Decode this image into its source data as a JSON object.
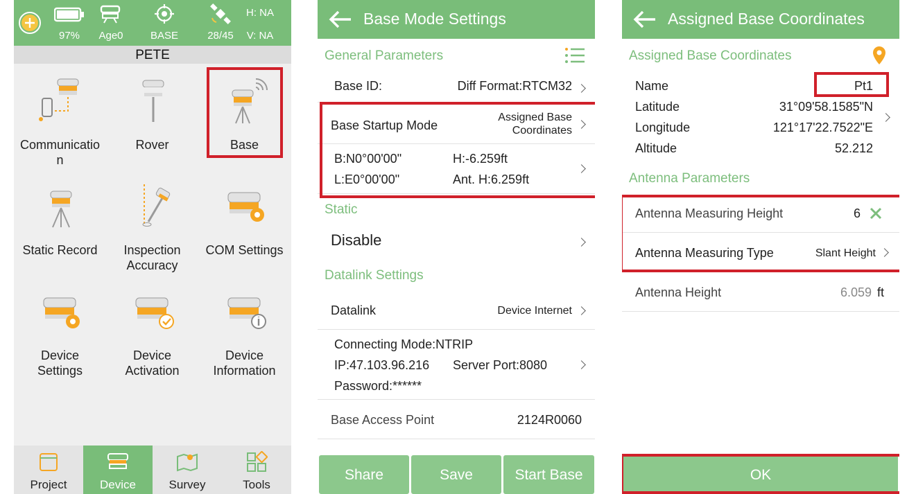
{
  "device_menu": {
    "status": {
      "battery": "97%",
      "age": "Age0",
      "base": "BASE",
      "satellites": "28/45",
      "h": "H: NA",
      "v": "V: NA"
    },
    "project_name": "PETE",
    "tiles": [
      {
        "label": "Communicatio\nn",
        "icon": "communication-icon"
      },
      {
        "label": "Rover",
        "icon": "rover-icon"
      },
      {
        "label": "Base",
        "icon": "base-icon"
      },
      {
        "label": "Static Record",
        "icon": "static-record-icon"
      },
      {
        "label": "Inspection\nAccuracy",
        "icon": "inspection-accuracy-icon"
      },
      {
        "label": "COM Settings",
        "icon": "com-settings-icon"
      },
      {
        "label": "Device\nSettings",
        "icon": "device-settings-icon"
      },
      {
        "label": "Device\nActivation",
        "icon": "device-activation-icon"
      },
      {
        "label": "Device\nInformation",
        "icon": "device-information-icon"
      }
    ],
    "nav": [
      {
        "label": "Project"
      },
      {
        "label": "Device"
      },
      {
        "label": "Survey"
      },
      {
        "label": "Tools"
      }
    ]
  },
  "base_mode": {
    "title": "Base Mode Settings",
    "general_parameters": "General Parameters",
    "base_id_label": "Base ID:",
    "diff_format": "Diff Format:RTCM32",
    "startup_label": "Base Startup Mode",
    "startup_value_1": "Assigned Base",
    "startup_value_2": "Coordinates",
    "b": "B:N0°00'00\"",
    "l": "L:E0°00'00\"",
    "h": "H:-6.259ft",
    "ant_h": "Ant. H:6.259ft",
    "static_section": "Static",
    "static_value": "Disable",
    "datalink_section": "Datalink Settings",
    "datalink_label": "Datalink",
    "datalink_value": "Device Internet",
    "connecting_mode": "Connecting Mode:NTRIP",
    "ip": "IP:47.103.96.216",
    "server_port": "Server Port:8080",
    "password": "Password:******",
    "access_point_label": "Base Access Point",
    "access_point_value": "2124R0060",
    "buttons": {
      "share": "Share",
      "save": "Save",
      "start": "Start Base"
    }
  },
  "assigned": {
    "title": "Assigned Base Coordinates",
    "section": "Assigned Base Coordinates",
    "name_label": "Name",
    "name_value": "Pt1",
    "lat_label": "Latitude",
    "lat_value": "31°09'58.1585\"N",
    "lon_label": "Longitude",
    "lon_value": "121°17'22.7522\"E",
    "alt_label": "Altitude",
    "alt_value": "52.212",
    "antenna_section": "Antenna Parameters",
    "amh_label": "Antenna Measuring Height",
    "amh_value": "6",
    "amt_label": "Antenna Measuring Type",
    "amt_value": "Slant Height",
    "ah_label": "Antenna Height",
    "ah_value": "6.059",
    "ah_unit": "ft",
    "ok": "OK"
  },
  "colors": {
    "accent": "#79bd79",
    "highlight": "#d0202a",
    "device_orange": "#f5a623"
  }
}
